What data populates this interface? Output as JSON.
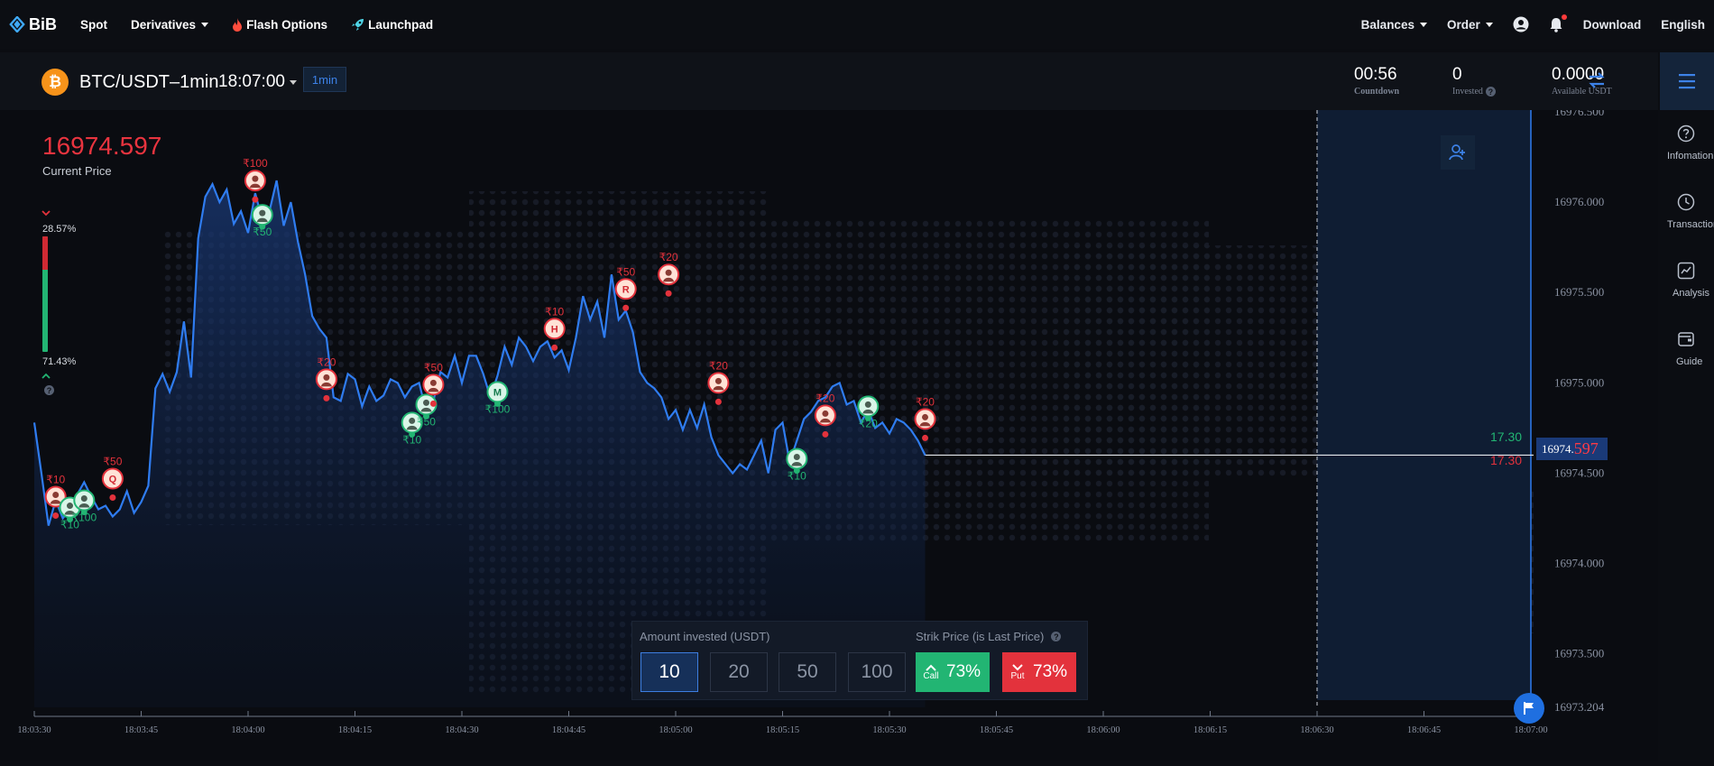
{
  "nav": {
    "logo": "BiB",
    "links": [
      "Spot",
      "Derivatives",
      "Flash Options",
      "Launchpad"
    ],
    "right": {
      "balances": "Balances",
      "order": "Order",
      "download": "Download",
      "language": "English"
    }
  },
  "ticker": {
    "pair": "BTC/USDT–1min",
    "time": "18:07:00",
    "interval": "1min",
    "coin_symbol": "₿",
    "countdown": {
      "value": "00:56",
      "label": "Countdown"
    },
    "invested": {
      "value": "0",
      "label": "Invested"
    },
    "available": {
      "value": "0.0000",
      "label": "Available USDT"
    }
  },
  "sidebar": [
    "Infomation",
    "Transaction",
    "Analysis",
    "Guide"
  ],
  "price": {
    "current": "16974.597",
    "label": "Current Price",
    "tag_main": "16974.",
    "tag_tail": "597",
    "up_amount": "17.30",
    "down_amount": "17.30"
  },
  "sentiment": {
    "put_pct": "28.57%",
    "call_pct": "71.43%",
    "put_fraction": 0.2857,
    "call_fraction": 0.7143
  },
  "trade_panel": {
    "amount_label": "Amount invested (USDT)",
    "strike_label": "Strik Price (is Last Price)",
    "amounts": [
      "10",
      "20",
      "50",
      "100"
    ],
    "selected_amount": "10",
    "call": {
      "label": "Call",
      "pct": "73%"
    },
    "put": {
      "label": "Put",
      "pct": "73%"
    }
  },
  "colors": {
    "line": "#2f7cf0",
    "up": "#22b573",
    "down": "#e3323c",
    "accent": "#3d82e8"
  },
  "chart_data": {
    "type": "area",
    "ylim": [
      16973.204,
      16976.5
    ],
    "yticks": [
      "16976.500",
      "16976.000",
      "16975.500",
      "16975.000",
      "16974.500",
      "16974.000",
      "16973.500",
      "16973.204"
    ],
    "xticks": [
      "18:03:30",
      "18:03:45",
      "18:04:00",
      "18:04:15",
      "18:04:30",
      "18:04:45",
      "18:05:00",
      "18:05:15",
      "18:05:30",
      "18:05:45",
      "18:06:00",
      "18:06:15",
      "18:06:30",
      "18:06:45",
      "18:07:00"
    ],
    "xlim_seconds": [
      0,
      210
    ],
    "settle_line_seconds": 180,
    "series": [
      {
        "t": [
          0,
          1,
          2,
          3,
          4,
          5,
          6,
          7,
          8,
          9,
          10,
          11,
          12,
          13,
          14,
          15,
          16,
          17,
          18,
          19,
          20,
          21,
          22,
          23,
          24,
          25,
          26,
          27,
          28,
          29,
          30,
          31,
          32,
          33,
          34,
          35,
          36,
          37,
          38,
          39,
          40,
          41,
          42,
          43,
          44,
          45,
          46,
          47,
          48,
          49,
          50,
          51,
          52,
          53,
          54,
          55,
          56,
          57,
          58,
          59,
          60,
          61,
          62,
          63,
          64,
          65,
          66,
          67,
          68,
          69,
          70,
          71,
          72,
          73,
          74,
          75,
          76,
          77,
          78,
          79,
          80,
          81,
          82,
          83,
          84,
          85,
          86,
          87,
          88,
          89,
          90,
          91,
          92,
          93,
          94,
          95,
          96,
          97,
          98,
          99,
          100,
          101,
          102,
          103,
          104,
          105,
          106,
          107,
          108,
          109,
          110,
          111,
          112,
          113,
          114,
          115,
          116,
          117,
          118,
          119,
          120,
          121,
          122,
          123,
          124,
          125
        ],
        "y": [
          16974.78,
          16974.5,
          16974.21,
          16974.35,
          16974.25,
          16974.3,
          16974.38,
          16974.45,
          16974.37,
          16974.3,
          16974.32,
          16974.26,
          16974.3,
          16974.4,
          16974.28,
          16974.34,
          16974.43,
          16974.97,
          16975.05,
          16974.95,
          16975.06,
          16975.34,
          16975.03,
          16975.8,
          16976.03,
          16976.1,
          16976.0,
          16976.07,
          16975.88,
          16975.95,
          16975.83,
          16976.05,
          16975.9,
          16975.95,
          16976.12,
          16975.87,
          16976.0,
          16975.78,
          16975.6,
          16975.37,
          16975.3,
          16975.25,
          16974.92,
          16974.9,
          16975.05,
          16975.02,
          16974.87,
          16974.98,
          16974.9,
          16974.93,
          16975.02,
          16975.0,
          16974.92,
          16974.98,
          16975.0,
          16974.84,
          16974.9,
          16975.06,
          16975.03,
          16975.15,
          16975.0,
          16975.15,
          16975.15,
          16975.05,
          16974.92,
          16975.04,
          16975.2,
          16975.1,
          16975.25,
          16975.2,
          16975.12,
          16975.2,
          16975.23,
          16975.14,
          16975.18,
          16975.07,
          16975.25,
          16975.48,
          16975.35,
          16975.45,
          16975.25,
          16975.6,
          16975.35,
          16975.4,
          16975.28,
          16975.06,
          16975.0,
          16974.97,
          16974.92,
          16974.8,
          16974.85,
          16974.74,
          16974.85,
          16974.75,
          16974.88,
          16974.7,
          16974.6,
          16974.55,
          16974.5,
          16974.55,
          16974.52,
          16974.6,
          16974.68,
          16974.5,
          16974.74,
          16974.78,
          16974.56,
          16974.68,
          16974.8,
          16974.84,
          16974.9,
          16974.92,
          16974.98,
          16975.0,
          16974.88,
          16974.9,
          16974.78,
          16974.85,
          16974.75,
          16974.78,
          16974.72,
          16974.8,
          16974.78,
          16974.74,
          16974.68,
          16974.6
        ]
      }
    ],
    "annotations": [
      {
        "t": 3,
        "y": 16974.3,
        "text": "₹10",
        "side": "down"
      },
      {
        "t": 5,
        "y": 16974.28,
        "text": "₹10",
        "side": "up"
      },
      {
        "t": 7,
        "y": 16974.32,
        "text": "₹100",
        "side": "up"
      },
      {
        "t": 11,
        "y": 16974.4,
        "text": "₹50",
        "side": "down",
        "initial": "Q"
      },
      {
        "t": 31,
        "y": 16976.05,
        "text": "₹100",
        "side": "down"
      },
      {
        "t": 32,
        "y": 16975.9,
        "text": "₹50",
        "side": "up"
      },
      {
        "t": 41,
        "y": 16974.95,
        "text": "₹20",
        "side": "down"
      },
      {
        "t": 53,
        "y": 16974.75,
        "text": "₹10",
        "side": "up"
      },
      {
        "t": 55,
        "y": 16974.85,
        "text": "₹50",
        "side": "up"
      },
      {
        "t": 56,
        "y": 16974.92,
        "text": "₹50",
        "side": "down"
      },
      {
        "t": 65,
        "y": 16974.92,
        "text": "₹100",
        "side": "up",
        "initial": "M"
      },
      {
        "t": 73,
        "y": 16975.23,
        "text": "₹10",
        "side": "down",
        "initial": "H"
      },
      {
        "t": 83,
        "y": 16975.45,
        "text": "₹50",
        "side": "down",
        "initial": "R"
      },
      {
        "t": 89,
        "y": 16975.53,
        "text": "₹20",
        "side": "down"
      },
      {
        "t": 96,
        "y": 16974.93,
        "text": "₹20",
        "side": "down"
      },
      {
        "t": 107,
        "y": 16974.55,
        "text": "₹10",
        "side": "up"
      },
      {
        "t": 111,
        "y": 16974.75,
        "text": "₹20",
        "side": "down"
      },
      {
        "t": 117,
        "y": 16974.84,
        "text": "₹20",
        "side": "up"
      },
      {
        "t": 125,
        "y": 16974.73,
        "text": "₹20",
        "side": "down"
      }
    ]
  }
}
